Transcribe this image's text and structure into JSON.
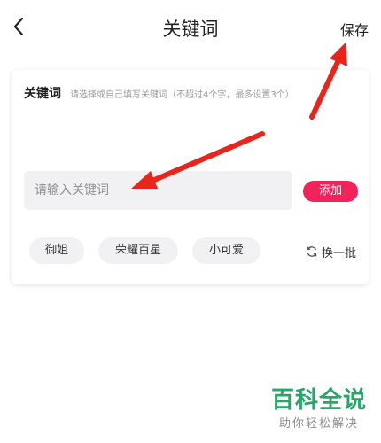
{
  "header": {
    "title": "关键词",
    "save_label": "保存"
  },
  "keyword_card": {
    "label": "关键词",
    "hint": "请选择或自己填写关键词（不超过4个字，最多设置3个）",
    "input_placeholder": "请输入关键词",
    "input_value": "",
    "add_label": "添加",
    "suggestions": [
      "御姐",
      "荣耀百星",
      "小可爱"
    ],
    "refresh_label": "换一批"
  },
  "colors": {
    "accent": "#f0245a",
    "annotation_arrow": "#e8241b",
    "watermark_green": "#2aa56a"
  },
  "watermark": {
    "main": "百科全说",
    "sub": "助你轻松解决"
  }
}
